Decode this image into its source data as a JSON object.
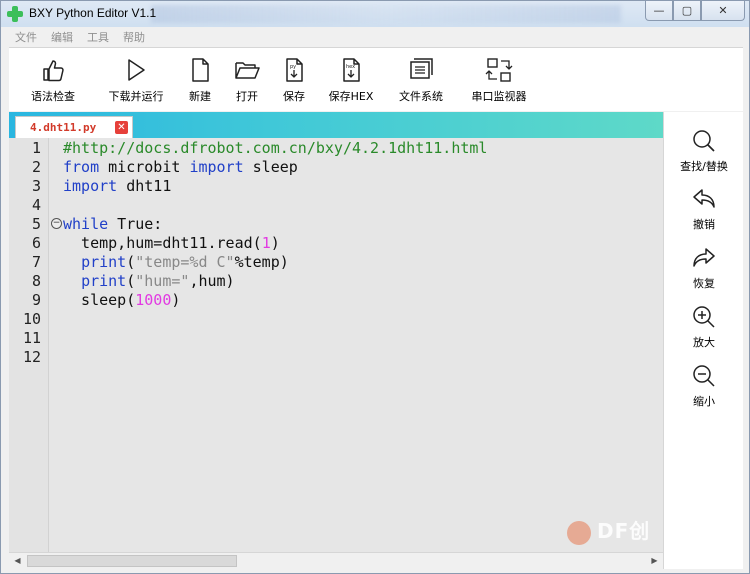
{
  "window": {
    "title": "BXY Python Editor V1.1",
    "minimize": "—",
    "maximize": "▢",
    "close": "✕"
  },
  "menu": [
    "文件",
    "编辑",
    "工具",
    "帮助"
  ],
  "toolbar": [
    {
      "label": "语法检查",
      "icon": "thumbs-up-icon"
    },
    {
      "label": "下载并运行",
      "icon": "play-icon"
    },
    {
      "label": "新建",
      "icon": "new-file-icon"
    },
    {
      "label": "打开",
      "icon": "folder-open-icon"
    },
    {
      "label": "保存",
      "icon": "save-py-icon"
    },
    {
      "label": "保存HEX",
      "icon": "save-hex-icon"
    },
    {
      "label": "文件系统",
      "icon": "file-system-icon"
    },
    {
      "label": "串口监视器",
      "icon": "serial-monitor-icon"
    }
  ],
  "tab": {
    "filename": "4.dht11.py",
    "close": "✕"
  },
  "editor": {
    "line_numbers": [
      "1",
      "2",
      "3",
      "4",
      "5",
      "6",
      "7",
      "8",
      "9",
      "10",
      "11",
      "12"
    ],
    "fold_marker": "−"
  },
  "side_panel": [
    {
      "label": "查找/替换",
      "icon": "search-icon"
    },
    {
      "label": "撤销",
      "icon": "undo-icon"
    },
    {
      "label": "恢复",
      "icon": "redo-icon"
    },
    {
      "label": "放大",
      "icon": "zoom-in-icon"
    },
    {
      "label": "缩小",
      "icon": "zoom-out-icon"
    }
  ],
  "watermark": "DF创",
  "colors": {
    "keyword": "#2140c8",
    "comment": "#2a8a2a",
    "string": "#888888",
    "number": "#e23ae2",
    "tab_strip_start": "#2ab6e0",
    "tab_strip_end": "#5ed9c8"
  },
  "code": [
    [
      {
        "t": "#http://docs.dfrobot.com.cn/bxy/4.2.1dht11.html",
        "c": "comment"
      }
    ],
    [
      {
        "t": "from",
        "c": "kw"
      },
      {
        "t": " microbit ",
        "c": "plain"
      },
      {
        "t": "import",
        "c": "kw"
      },
      {
        "t": " sleep",
        "c": "plain"
      }
    ],
    [
      {
        "t": "import",
        "c": "kw"
      },
      {
        "t": " dht11",
        "c": "plain"
      }
    ],
    [],
    [
      {
        "t": "while",
        "c": "kw"
      },
      {
        "t": " True:",
        "c": "plain"
      }
    ],
    [
      {
        "t": "  temp,hum=dht11.read(",
        "c": "plain"
      },
      {
        "t": "1",
        "c": "num"
      },
      {
        "t": ")",
        "c": "plain"
      }
    ],
    [
      {
        "t": "  ",
        "c": "plain"
      },
      {
        "t": "print",
        "c": "kw"
      },
      {
        "t": "(",
        "c": "plain"
      },
      {
        "t": "\"temp=%d C\"",
        "c": "str"
      },
      {
        "t": "%temp)",
        "c": "plain"
      }
    ],
    [
      {
        "t": "  ",
        "c": "plain"
      },
      {
        "t": "print",
        "c": "kw"
      },
      {
        "t": "(",
        "c": "plain"
      },
      {
        "t": "\"hum=\"",
        "c": "str"
      },
      {
        "t": ",hum)",
        "c": "plain"
      }
    ],
    [
      {
        "t": "  sleep(",
        "c": "plain"
      },
      {
        "t": "1000",
        "c": "num"
      },
      {
        "t": ")",
        "c": "plain"
      }
    ],
    [],
    [],
    []
  ]
}
